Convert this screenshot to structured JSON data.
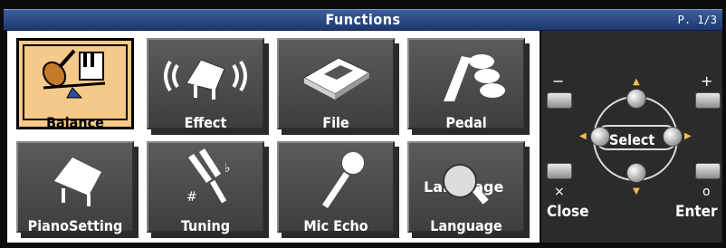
{
  "header": {
    "title": "Functions",
    "page_indicator": "P. 1/3"
  },
  "tiles": [
    {
      "label": "Balance",
      "icon": "violin-and-piano-balance-icon",
      "selected": true
    },
    {
      "label": "Effect",
      "icon": "grand-piano-sound-waves-icon"
    },
    {
      "label": "File",
      "icon": "floppy-disk-icon"
    },
    {
      "label": "Pedal",
      "icon": "pedals-icon"
    },
    {
      "label": "PianoSetting",
      "icon": "grand-piano-icon"
    },
    {
      "label": "Tuning",
      "icon": "tuning-fork-icon"
    },
    {
      "label": "Mic Echo",
      "icon": "microphone-icon"
    },
    {
      "label": "Language",
      "icon": "language-magnifier-icon",
      "icon_text": "Language"
    }
  ],
  "controls": {
    "minus_symbol": "−",
    "plus_symbol": "+",
    "x_symbol": "×",
    "o_symbol": "o",
    "select_label": "Select",
    "close_label": "Close",
    "enter_label": "Enter"
  }
}
